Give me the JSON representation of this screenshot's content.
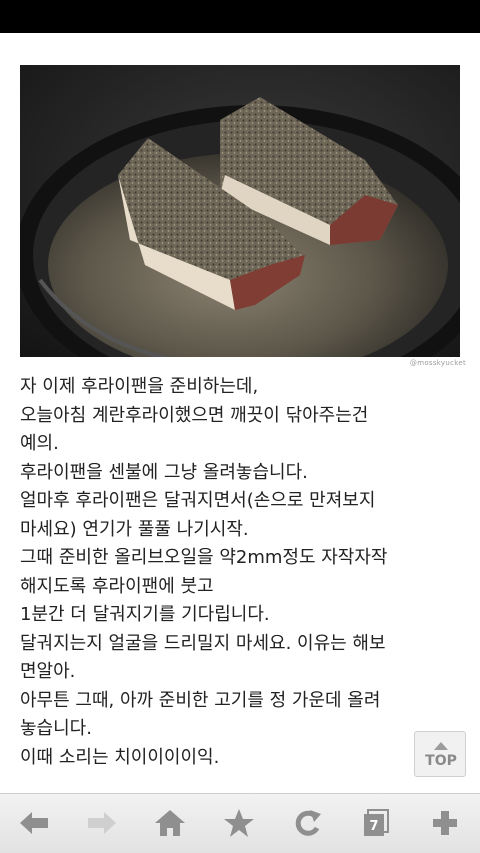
{
  "photo": {
    "alt": "photo-frying-steaks",
    "watermark": "@mosskyucket"
  },
  "article": {
    "lines": [
      "자 이제 후라이팬을 준비하는데,",
      "오늘아침 계란후라이했으면 깨끗이 닦아주는건",
      "예의.",
      "후라이팬을 센불에 그냥 올려놓습니다.",
      "얼마후 후라이팬은 달궈지면서(손으로 만져보지",
      "마세요) 연기가 풀풀 나기시작.",
      "그때 준비한 올리브오일을 약2mm정도 자작자작",
      "해지도록 후라이팬에 붓고",
      "1분간 더 달궈지기를 기다립니다.",
      "달궈지는지 얼굴을 드리밀지 마세요. 이유는 해보",
      "면알아.",
      "아무튼 그때, 아까 준비한 고기를 정 가운데 올려",
      "놓습니다.",
      "이때 소리는 치이이이이익."
    ]
  },
  "top_button": {
    "label": "TOP"
  },
  "toolbar": {
    "tab_count": "7",
    "icons": [
      "back-arrow-icon",
      "forward-arrow-icon",
      "home-icon",
      "star-icon",
      "refresh-icon",
      "tabs-icon",
      "plus-icon"
    ]
  },
  "colors": {
    "icon_gray": "#8f8f8f",
    "disabled_icon": "#cfcfcf"
  }
}
